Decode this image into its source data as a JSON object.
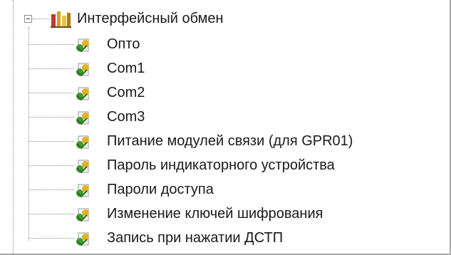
{
  "tree": {
    "root": {
      "label": "Интерфейсный обмен",
      "expanded": true,
      "icon": "folder-tools-icon"
    },
    "items": [
      {
        "label": "Опто",
        "icon": "parameter-leaf-icon"
      },
      {
        "label": "Com1",
        "icon": "parameter-leaf-icon"
      },
      {
        "label": "Com2",
        "icon": "parameter-leaf-icon"
      },
      {
        "label": "Com3",
        "icon": "parameter-leaf-icon"
      },
      {
        "label": "Питание модулей связи (для GPR01)",
        "icon": "parameter-leaf-icon"
      },
      {
        "label": "Пароль индикаторного устройства",
        "icon": "parameter-leaf-icon"
      },
      {
        "label": "Пароли доступа",
        "icon": "parameter-leaf-icon"
      },
      {
        "label": "Изменение ключей шифрования",
        "icon": "parameter-leaf-icon"
      },
      {
        "label": "Запись при нажатии ДСТП",
        "icon": "parameter-leaf-icon"
      }
    ]
  },
  "colors": {
    "text": "#1a1a1a",
    "tree_lines": "#8a8a8a",
    "border": "#a9a9a9",
    "leaf_icon_green": "#3f9b2f",
    "leaf_icon_yellow": "#e0b12a",
    "root_icon_red": "#c0392b",
    "root_icon_gold": "#d9a21a"
  }
}
